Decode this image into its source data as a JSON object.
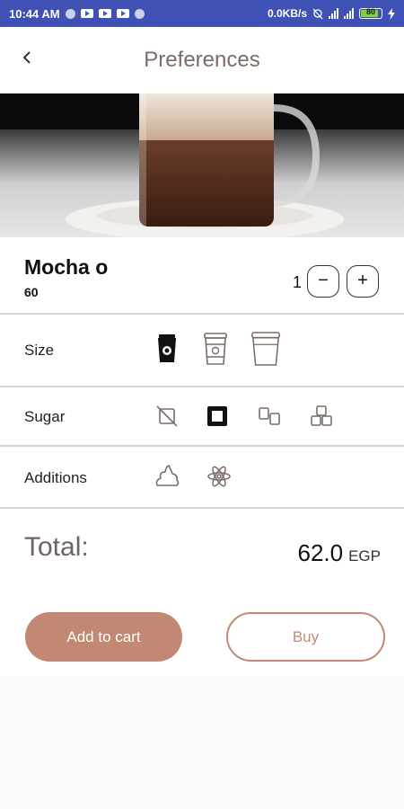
{
  "status_bar": {
    "time": "10:44 AM",
    "speed": "0.0KB/s",
    "battery": "80"
  },
  "header": {
    "title": "Preferences"
  },
  "product": {
    "name": "Mocha o",
    "price": "60",
    "quantity": "1",
    "minus_label": "−",
    "plus_label": "+"
  },
  "options": {
    "size": {
      "label": "Size",
      "items": [
        "small-cup-icon",
        "medium-cup-icon",
        "large-cup-icon"
      ],
      "selected_index": 0
    },
    "sugar": {
      "label": "Sugar",
      "items": [
        "no-sugar-icon",
        "one-sugar-cube-icon",
        "two-sugar-cubes-icon",
        "three-sugar-cubes-icon"
      ],
      "selected_index": 1
    },
    "additions": {
      "label": "Additions",
      "items": [
        "cream-icon",
        "cinnamon-icon"
      ]
    }
  },
  "total": {
    "label": "Total:",
    "value": "62.0",
    "currency": "EGP"
  },
  "actions": {
    "add_to_cart": "Add to cart",
    "buy": "Buy"
  },
  "colors": {
    "accent": "#c28874",
    "status_bar": "#3f51b5",
    "title": "#7a6c66"
  }
}
